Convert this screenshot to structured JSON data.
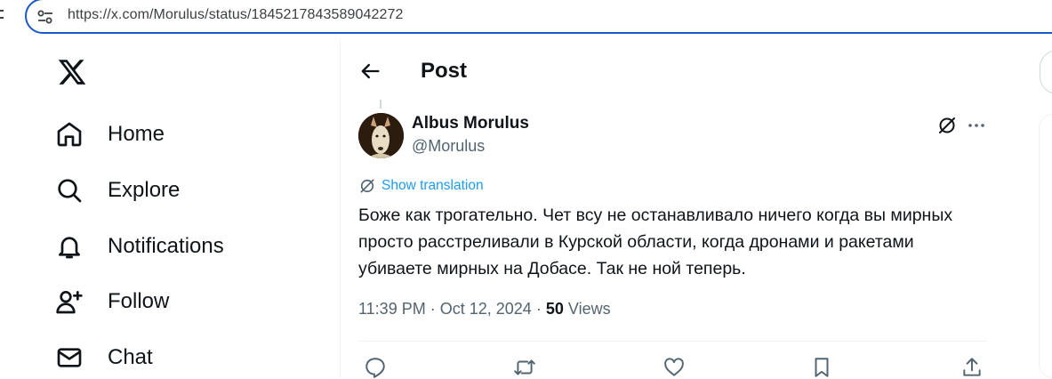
{
  "browser": {
    "url": "https://x.com/Morulus/status/1845217843589042272"
  },
  "nav": {
    "logo_icon": "x-logo-icon",
    "items": [
      {
        "label": "Home",
        "icon": "home-icon"
      },
      {
        "label": "Explore",
        "icon": "search-icon"
      },
      {
        "label": "Notifications",
        "icon": "bell-icon"
      },
      {
        "label": "Follow",
        "icon": "person-add-icon"
      },
      {
        "label": "Chat",
        "icon": "envelope-icon"
      }
    ]
  },
  "header": {
    "title": "Post",
    "back_icon": "back-arrow-icon"
  },
  "tweet": {
    "author_name": "Albus Morulus",
    "author_handle": "@Morulus",
    "translate_label": "Show translation",
    "text": "Боже как трогательно. Чет всу не останавливало ничего когда вы мирных просто расстреливали в Курской области, когда дронами и ракетами убиваете мирных на Добасе. Так не ной теперь.",
    "time": "11:39 PM",
    "separator": "·",
    "date": "Oct 12, 2024",
    "views_count": "50",
    "views_label": "Views"
  },
  "actions": [
    "reply-icon",
    "repost-icon",
    "like-icon",
    "bookmark-icon",
    "share-icon"
  ],
  "colors": {
    "accent": "#1d9bf0",
    "text_primary": "#0f1419",
    "text_secondary": "#536471",
    "url_bar_border": "#1a56c4"
  }
}
